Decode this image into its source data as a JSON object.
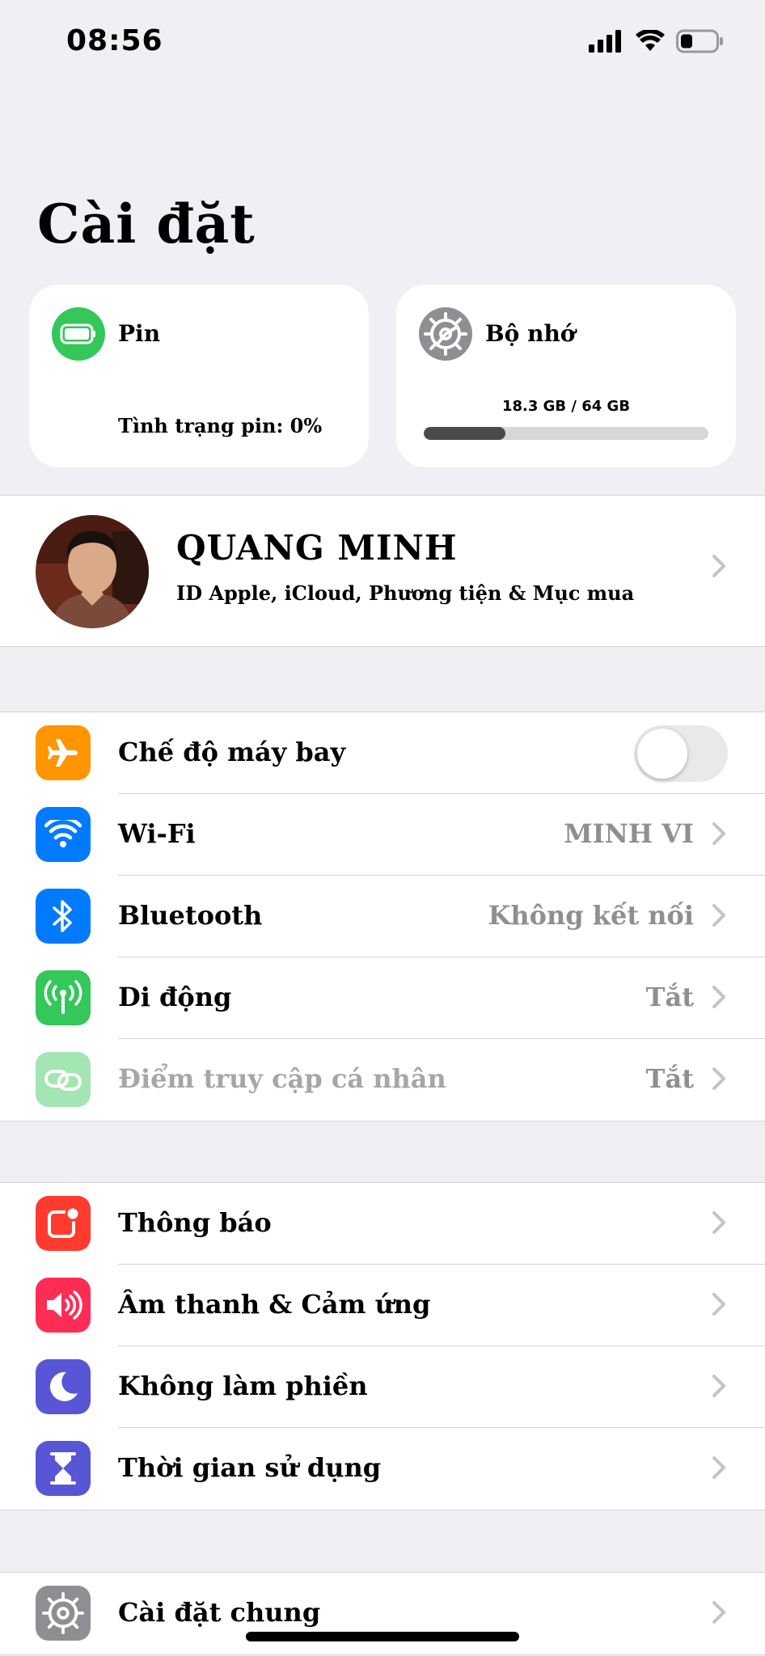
{
  "status_bar": {
    "time": "08:56"
  },
  "page_title": "Cài đặt",
  "widgets": {
    "battery": {
      "title": "Pin",
      "status": "Tình trạng pin: 0%",
      "color": "#34c759"
    },
    "storage": {
      "title": "Bộ nhớ",
      "usage_text": "18.3 GB / 64 GB",
      "used_fraction": 0.286
    }
  },
  "profile": {
    "name": "QUANG MINH",
    "subtitle": "ID Apple, iCloud, Phương tiện & Mục mua"
  },
  "connectivity": [
    {
      "label": "Chế độ máy bay",
      "icon": "airplane-icon",
      "color": "#ff9500",
      "toggle": false
    },
    {
      "label": "Wi-Fi",
      "icon": "wifi-icon",
      "color": "#007aff",
      "value": "MINH VI"
    },
    {
      "label": "Bluetooth",
      "icon": "bluetooth-icon",
      "color": "#007aff",
      "value": "Không kết nối"
    },
    {
      "label": "Di động",
      "icon": "cellular-icon",
      "color": "#34c759",
      "value": "Tắt"
    },
    {
      "label": "Điểm truy cập cá nhân",
      "icon": "hotspot-icon",
      "color": "#34c759",
      "value": "Tắt",
      "disabled": true
    }
  ],
  "notifications": [
    {
      "label": "Thông báo",
      "icon": "notifications-icon",
      "color": "#ff3b30"
    },
    {
      "label": "Âm thanh & Cảm ứng",
      "icon": "sound-icon",
      "color": "#ff2d55"
    },
    {
      "label": "Không làm phiền",
      "icon": "moon-icon",
      "color": "#5856d6"
    },
    {
      "label": "Thời gian sử dụng",
      "icon": "hourglass-icon",
      "color": "#5856d6"
    }
  ],
  "general": [
    {
      "label": "Cài đặt chung",
      "icon": "gear-icon",
      "color": "#8e8e93"
    }
  ]
}
